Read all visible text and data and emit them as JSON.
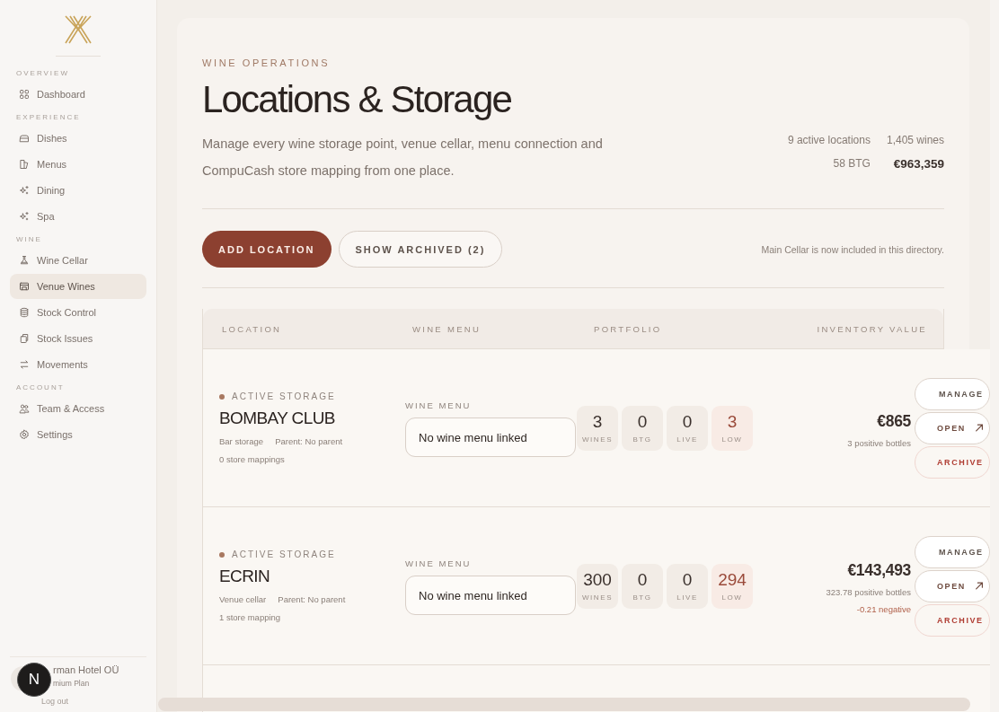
{
  "sidebar": {
    "sections": [
      {
        "label": "OVERVIEW",
        "items": [
          {
            "label": "Dashboard",
            "selected": false
          }
        ]
      },
      {
        "label": "EXPERIENCE",
        "items": [
          {
            "label": "Dishes",
            "selected": false
          },
          {
            "label": "Menus",
            "selected": false
          },
          {
            "label": "Dining",
            "selected": false
          },
          {
            "label": "Spa",
            "selected": false
          }
        ]
      },
      {
        "label": "WINE",
        "items": [
          {
            "label": "Wine Cellar",
            "selected": false
          },
          {
            "label": "Venue Wines",
            "selected": true
          },
          {
            "label": "Stock Control",
            "selected": false
          },
          {
            "label": "Stock Issues",
            "selected": false
          },
          {
            "label": "Movements",
            "selected": false
          }
        ]
      },
      {
        "label": "ACCOUNT",
        "items": [
          {
            "label": "Team & Access",
            "selected": false
          },
          {
            "label": "Settings",
            "selected": false
          }
        ]
      }
    ],
    "account": {
      "name": "rman Hotel OÜ",
      "plan": "mium Plan",
      "logout": "Log out",
      "badge": "N"
    }
  },
  "header": {
    "eyebrow": "WINE OPERATIONS",
    "title": "Locations & Storage",
    "description": "Manage every wine storage point, venue cellar, menu connection and CompuCash store mapping from one place.",
    "stats": [
      [
        "9 active locations",
        "1,405 wines"
      ],
      [
        "58 BTG",
        "€963,359"
      ]
    ]
  },
  "toolbar": {
    "buttons": [
      {
        "label": "ADD LOCATION",
        "kind": "primary"
      },
      {
        "label": "SHOW ARCHIVED (2)",
        "kind": "secondary"
      }
    ],
    "note": "Main Cellar is now included in this directory."
  },
  "table": {
    "columns": [
      "LOCATION",
      "WINE MENU",
      "PORTFOLIO",
      "INVENTORY VALUE"
    ],
    "rows": [
      {
        "status": "ACTIVE STORAGE",
        "name": "BOMBAY CLUB",
        "type": "Bar storage",
        "parent": "Parent: No parent",
        "mappings": "0 store mappings",
        "menu_label": "WINE MENU",
        "menu_value": "No wine menu linked",
        "tiles": [
          {
            "value": "3",
            "label": "WINES",
            "kind": "normal"
          },
          {
            "value": "0",
            "label": "BTG",
            "kind": "normal"
          },
          {
            "value": "0",
            "label": "LIVE",
            "kind": "normal"
          },
          {
            "value": "3",
            "label": "LOW",
            "kind": "alert"
          }
        ],
        "value": "€865",
        "notes": [
          {
            "text": "3 positive bottles",
            "kind": "normal"
          }
        ],
        "actions": [
          {
            "label": "MANAGE",
            "kind": "normal"
          },
          {
            "label": "OPEN",
            "kind": "open"
          },
          {
            "label": "ARCHIVE",
            "kind": "danger"
          }
        ]
      },
      {
        "status": "ACTIVE STORAGE",
        "name": "ECRIN",
        "type": "Venue cellar",
        "parent": "Parent: No parent",
        "mappings": "1 store mapping",
        "menu_label": "WINE MENU",
        "menu_value": "No wine menu linked",
        "tiles": [
          {
            "value": "300",
            "label": "WINES",
            "kind": "normal"
          },
          {
            "value": "0",
            "label": "BTG",
            "kind": "normal"
          },
          {
            "value": "0",
            "label": "LIVE",
            "kind": "normal"
          },
          {
            "value": "294",
            "label": "LOW",
            "kind": "alert"
          }
        ],
        "value": "€143,493",
        "notes": [
          {
            "text": "323.78 positive bottles",
            "kind": "normal"
          },
          {
            "text": "-0.21 negative",
            "kind": "negative"
          }
        ],
        "actions": [
          {
            "label": "MANAGE",
            "kind": "normal"
          },
          {
            "label": "OPEN",
            "kind": "open"
          },
          {
            "label": "ARCHIVE",
            "kind": "danger"
          }
        ]
      }
    ]
  }
}
